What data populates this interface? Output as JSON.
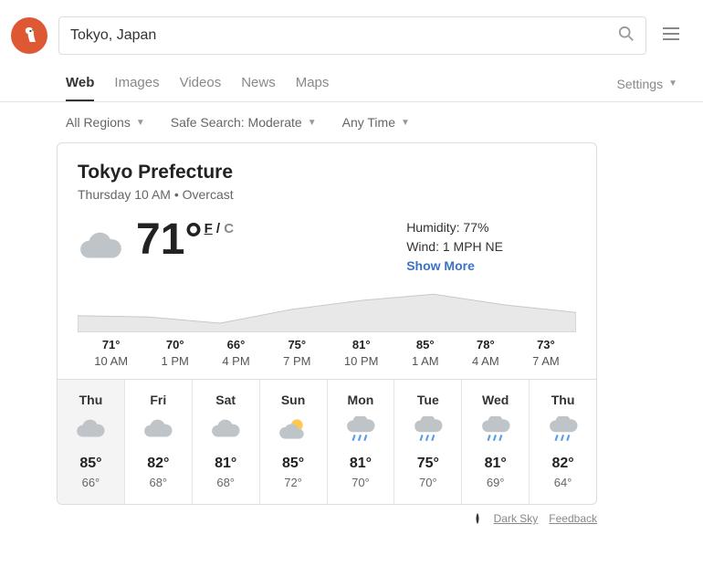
{
  "search": {
    "value": "Tokyo, Japan"
  },
  "tabs": [
    "Web",
    "Images",
    "Videos",
    "News",
    "Maps"
  ],
  "settings_label": "Settings",
  "filters": {
    "region": "All Regions",
    "safe": "Safe Search: Moderate",
    "time": "Any Time"
  },
  "weather": {
    "location": "Tokyo Prefecture",
    "subtitle": "Thursday 10 AM • Overcast",
    "temp": "71°",
    "unit_f": "F",
    "unit_sep": " / ",
    "unit_c": "C",
    "humidity": "Humidity: 77%",
    "wind": "Wind: 1 MPH NE",
    "show_more": "Show More"
  },
  "hourly": [
    {
      "t": "71°",
      "h": "10 AM"
    },
    {
      "t": "70°",
      "h": "1 PM"
    },
    {
      "t": "66°",
      "h": "4 PM"
    },
    {
      "t": "75°",
      "h": "7 PM"
    },
    {
      "t": "81°",
      "h": "10 PM"
    },
    {
      "t": "85°",
      "h": "1 AM"
    },
    {
      "t": "78°",
      "h": "4 AM"
    },
    {
      "t": "73°",
      "h": "7 AM"
    }
  ],
  "daily": [
    {
      "d": "Thu",
      "hi": "85°",
      "lo": "66°",
      "icon": "cloud",
      "active": true
    },
    {
      "d": "Fri",
      "hi": "82°",
      "lo": "68°",
      "icon": "cloud"
    },
    {
      "d": "Sat",
      "hi": "81°",
      "lo": "68°",
      "icon": "cloud"
    },
    {
      "d": "Sun",
      "hi": "85°",
      "lo": "72°",
      "icon": "sun"
    },
    {
      "d": "Mon",
      "hi": "81°",
      "lo": "70°",
      "icon": "rain"
    },
    {
      "d": "Tue",
      "hi": "75°",
      "lo": "70°",
      "icon": "rain"
    },
    {
      "d": "Wed",
      "hi": "81°",
      "lo": "69°",
      "icon": "rain"
    },
    {
      "d": "Thu",
      "hi": "82°",
      "lo": "64°",
      "icon": "rain"
    }
  ],
  "footer": {
    "source": "Dark Sky",
    "feedback": "Feedback"
  },
  "chart_data": {
    "type": "area",
    "x": [
      "10 AM",
      "1 PM",
      "4 PM",
      "7 PM",
      "10 PM",
      "1 AM",
      "4 AM",
      "7 AM"
    ],
    "values": [
      71,
      70,
      66,
      75,
      81,
      85,
      78,
      73
    ],
    "ylim": [
      60,
      90
    ]
  }
}
